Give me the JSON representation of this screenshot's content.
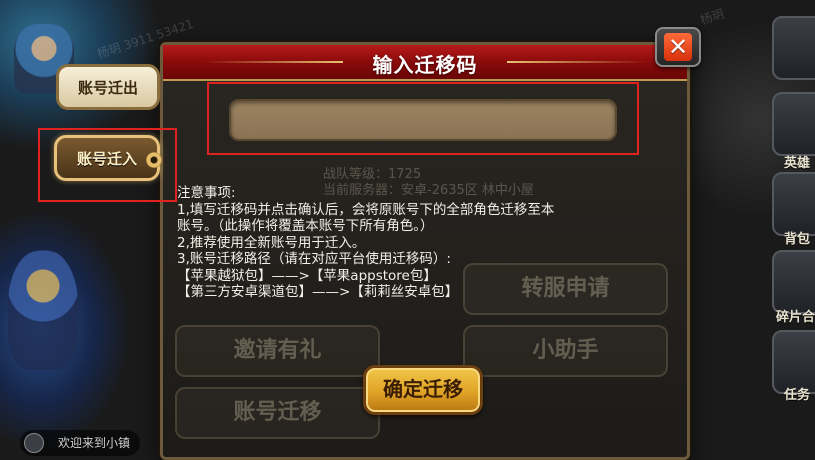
{
  "modal": {
    "title": "输入迁移码",
    "input_value": "",
    "input_placeholder": "",
    "confirm_label": "确定迁移",
    "close_glyph": "✕"
  },
  "side_tabs": {
    "out_label": "账号迁出",
    "in_label": "账号迁入"
  },
  "notes": [
    "注意事项:",
    "1,填写迁移码并点击确认后，会将原账号下的全部角色迁移至本",
    "账号。（此操作将覆盖本账号下所有角色。）",
    "2,推荐使用全新账号用于迁入。",
    "3,账号迁移路径（请在对应平台使用迁移码）:",
    "【苹果越狱包】——>【苹果appstore包】",
    "【第三方安卓渠道包】——>【莉莉丝安卓包】"
  ],
  "background": {
    "ghost_team": "战队等级：1725",
    "ghost_server": "当前服务器：安卓-2635区 林中小屋",
    "ghost_buttons": [
      "转服申请",
      "邀请有礼",
      "小助手",
      "账号迁移"
    ],
    "rail_labels": [
      "英雄",
      "背包",
      "碎片合",
      "任务"
    ],
    "welcome_text": "欢迎来到小镇",
    "watermark_name": "杨玥",
    "watermark_number": "3911 53421"
  },
  "colors": {
    "header_red": "#a01212",
    "highlight_red": "#e1231f",
    "gold": "#e0a326"
  }
}
